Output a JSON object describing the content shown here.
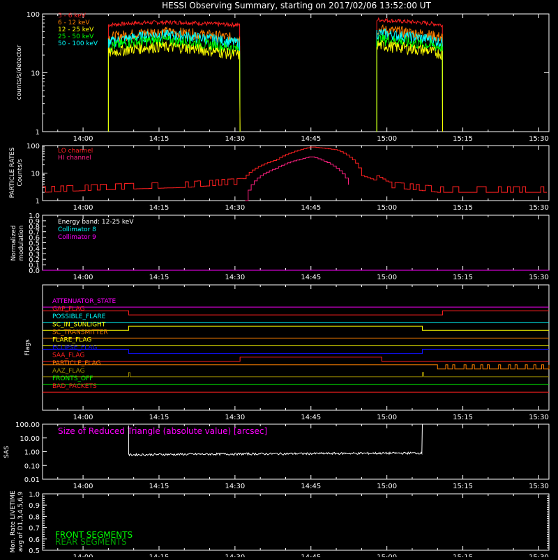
{
  "title": "HESSI Observing Summary, starting on 2017/02/06 13:52:00 UT",
  "time_ticks": [
    "14:00",
    "14:15",
    "14:30",
    "14:45",
    "15:00",
    "15:15",
    "15:30"
  ],
  "colors": {
    "background": "#000000",
    "axes": "#ffffff",
    "red": "#ff2020",
    "orange": "#ff8000",
    "yellow": "#ffff00",
    "green": "#00ff00",
    "cyan": "#00ffff",
    "magenta": "#ff00ff",
    "blue": "#1010ff",
    "olive": "#a09000"
  },
  "panels": {
    "lightcurve": {
      "ylabel": "counts/s/detector",
      "yticks": [
        "100",
        "10",
        "1"
      ],
      "legend": [
        {
          "label": "3 - 6 keV",
          "color": "#ff2020"
        },
        {
          "label": "6 - 12 keV",
          "color": "#ff8000"
        },
        {
          "label": "12 - 25 keV",
          "color": "#ffff00"
        },
        {
          "label": "25 - 50 keV",
          "color": "#00ff00"
        },
        {
          "label": "50 - 100 keV",
          "color": "#00ffff"
        }
      ]
    },
    "particle": {
      "ylabel1": "PARTICLE RATES",
      "ylabel2": "Counts/s",
      "yticks": [
        "100",
        "10",
        "1"
      ],
      "legend": [
        {
          "label": "LO channel",
          "color": "#ff2020"
        },
        {
          "label": "HI channel",
          "color": "#ff2080"
        }
      ]
    },
    "modulation": {
      "ylabel1": "Normalized",
      "ylabel2": "modulation",
      "yticks": [
        "1.0",
        "0.9",
        "0.8",
        "0.7",
        "0.6",
        "0.5",
        "0.4",
        "0.3",
        "0.2",
        "0.1",
        "0.0"
      ],
      "legend": [
        {
          "label": "Energy band: 12-25 keV",
          "color": "#ffffff"
        },
        {
          "label": "Collimator 8",
          "color": "#00ffff"
        },
        {
          "label": "Collimator 9",
          "color": "#ff00ff"
        }
      ]
    },
    "flags": {
      "ylabel": "Flags",
      "items": [
        {
          "label": "ATTENUATOR_STATE",
          "color": "#ff00ff"
        },
        {
          "label": "GAP_FLAG",
          "color": "#ff2020"
        },
        {
          "label": "POSSIBLE_FLARE",
          "color": "#00ffff"
        },
        {
          "label": "SC_IN_SUNLIGHT",
          "color": "#ffff00"
        },
        {
          "label": "SC_TRANSMITTER",
          "color": "#ff8000"
        },
        {
          "label": "FLARE_FLAG",
          "color": "#ffff00"
        },
        {
          "label": "ECLIPSE_FLAG",
          "color": "#1010ff"
        },
        {
          "label": "SAA_FLAG",
          "color": "#ff2020"
        },
        {
          "label": "PARTICLE_FLAG",
          "color": "#ff8000"
        },
        {
          "label": "AAZ_FLAG",
          "color": "#a09000"
        },
        {
          "label": "FRONTS_OFF",
          "color": "#00ff00"
        },
        {
          "label": "BAD_PACKETS",
          "color": "#ff2020"
        }
      ]
    },
    "sas": {
      "ylabel": "SAS",
      "yticks": [
        "100.00",
        "10.00",
        "1.00",
        "0.10",
        "0.01"
      ],
      "annotation": "Size of Reduced Triangle (absolute value) [arcsec]"
    },
    "livetime": {
      "ylabel1": "Mon. Rate LIVETIME",
      "ylabel2": "avg of D1,3,4,5,6,9",
      "yticks": [
        "1.0",
        "0.9",
        "0.8",
        "0.7",
        "0.6",
        "0.5"
      ],
      "legend": [
        {
          "label": "FRONT SEGMENTS",
          "color": "#00ff00"
        },
        {
          "label": "REAR SEGMENTS",
          "color": "#00a000"
        }
      ]
    }
  },
  "chart_data": {
    "type": "line",
    "title": "HESSI Observing Summary, starting on 2017/02/06 13:52:00 UT",
    "x_unit": "UT time",
    "xlim": [
      "13:52",
      "15:32"
    ],
    "lightcurve_series": [
      {
        "name": "3 - 6 keV",
        "x": [
          "14:05",
          "14:10",
          "14:15",
          "14:20",
          "14:25",
          "14:31",
          "14:58",
          "15:03",
          "15:08",
          "15:11"
        ],
        "values": [
          65,
          70,
          72,
          72,
          68,
          65,
          80,
          75,
          70,
          65
        ]
      },
      {
        "name": "6 - 12 keV",
        "x": [
          "14:05",
          "14:10",
          "14:15",
          "14:20",
          "14:25",
          "14:31",
          "14:58",
          "15:03",
          "15:08",
          "15:11"
        ],
        "values": [
          40,
          46,
          50,
          48,
          44,
          38,
          55,
          50,
          45,
          40
        ]
      },
      {
        "name": "12 - 25 keV",
        "x": [
          "14:05",
          "14:10",
          "14:15",
          "14:20",
          "14:25",
          "14:31",
          "14:58",
          "15:03",
          "15:08",
          "15:11"
        ],
        "values": [
          22,
          26,
          28,
          27,
          24,
          20,
          30,
          27,
          24,
          21
        ]
      },
      {
        "name": "25 - 50 keV",
        "x": [
          "14:05",
          "14:10",
          "14:15",
          "14:20",
          "14:25",
          "14:31",
          "14:58",
          "15:03",
          "15:08",
          "15:11"
        ],
        "values": [
          28,
          33,
          36,
          34,
          30,
          25,
          38,
          34,
          30,
          27
        ]
      },
      {
        "name": "50 - 100 keV",
        "x": [
          "14:05",
          "14:10",
          "14:15",
          "14:20",
          "14:25",
          "14:31",
          "14:58",
          "15:03",
          "15:08",
          "15:11"
        ],
        "values": [
          33,
          40,
          45,
          42,
          38,
          32,
          48,
          42,
          38,
          33
        ]
      }
    ],
    "particle_series": [
      {
        "name": "LO channel",
        "x": [
          "13:52",
          "14:05",
          "14:20",
          "14:31",
          "14:38",
          "14:45",
          "14:50",
          "14:55",
          "15:00",
          "15:10",
          "15:32"
        ],
        "values": [
          2,
          2.5,
          3,
          4,
          30,
          90,
          70,
          8,
          3,
          2,
          2
        ]
      },
      {
        "name": "HI channel",
        "x": [
          "14:32",
          "14:38",
          "14:45",
          "14:50",
          "14:53"
        ],
        "values": [
          1,
          15,
          40,
          15,
          1
        ]
      }
    ],
    "sas_series": {
      "name": "Size of Reduced Triangle (absolute value) [arcsec]",
      "x": [
        "14:09",
        "14:20",
        "14:35",
        "14:50",
        "15:07"
      ],
      "values": [
        0.6,
        0.65,
        0.7,
        0.75,
        0.8
      ]
    },
    "flag_events": {
      "GAP_FLAG_low": [
        "14:09",
        "15:11"
      ],
      "SC_IN_SUNLIGHT_high": [
        "14:09",
        "15:07"
      ],
      "ECLIPSE_FLAG_low": [
        "14:09",
        "15:07"
      ],
      "SAA_FLAG_high": [
        "14:31",
        "14:59"
      ],
      "PARTICLE_FLAG_high": [
        "14:31",
        "15:10"
      ]
    }
  }
}
